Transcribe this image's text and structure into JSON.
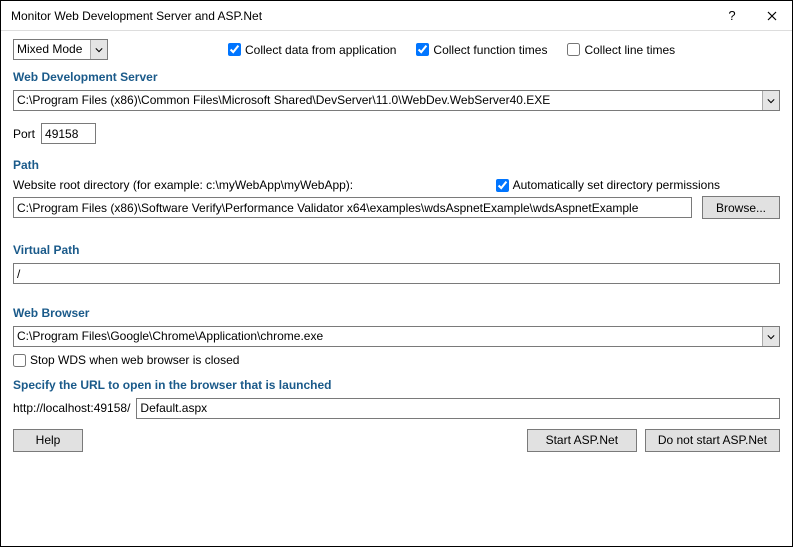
{
  "window": {
    "title": "Monitor Web Development Server and ASP.Net"
  },
  "topbar": {
    "mode_selected": "Mixed Mode",
    "collect_app_label": "Collect data from application",
    "collect_app_checked": true,
    "collect_func_label": "Collect function times",
    "collect_func_checked": true,
    "collect_line_label": "Collect line times",
    "collect_line_checked": false
  },
  "wds": {
    "heading": "Web Development Server",
    "path": "C:\\Program Files (x86)\\Common Files\\Microsoft Shared\\DevServer\\11.0\\WebDev.WebServer40.EXE",
    "port_label": "Port",
    "port_value": "49158"
  },
  "path": {
    "heading": "Path",
    "root_label": "Website root directory (for example: c:\\myWebApp\\myWebApp):",
    "auto_perm_label": "Automatically set directory permissions",
    "auto_perm_checked": true,
    "root_value": "C:\\Program Files (x86)\\Software Verify\\Performance Validator x64\\examples\\wdsAspnetExample\\wdsAspnetExample",
    "browse_label": "Browse..."
  },
  "vpath": {
    "heading": "Virtual Path",
    "value": "/"
  },
  "browser": {
    "heading": "Web Browser",
    "path": "C:\\Program Files\\Google\\Chrome\\Application\\chrome.exe",
    "stop_wds_label": "Stop WDS when web browser is closed",
    "stop_wds_checked": false
  },
  "url": {
    "heading": "Specify the URL to open in the browser that is launched",
    "prefix": "http://localhost:49158/",
    "value": "Default.aspx"
  },
  "buttons": {
    "help": "Help",
    "start": "Start ASP.Net",
    "no_start": "Do not start ASP.Net"
  }
}
